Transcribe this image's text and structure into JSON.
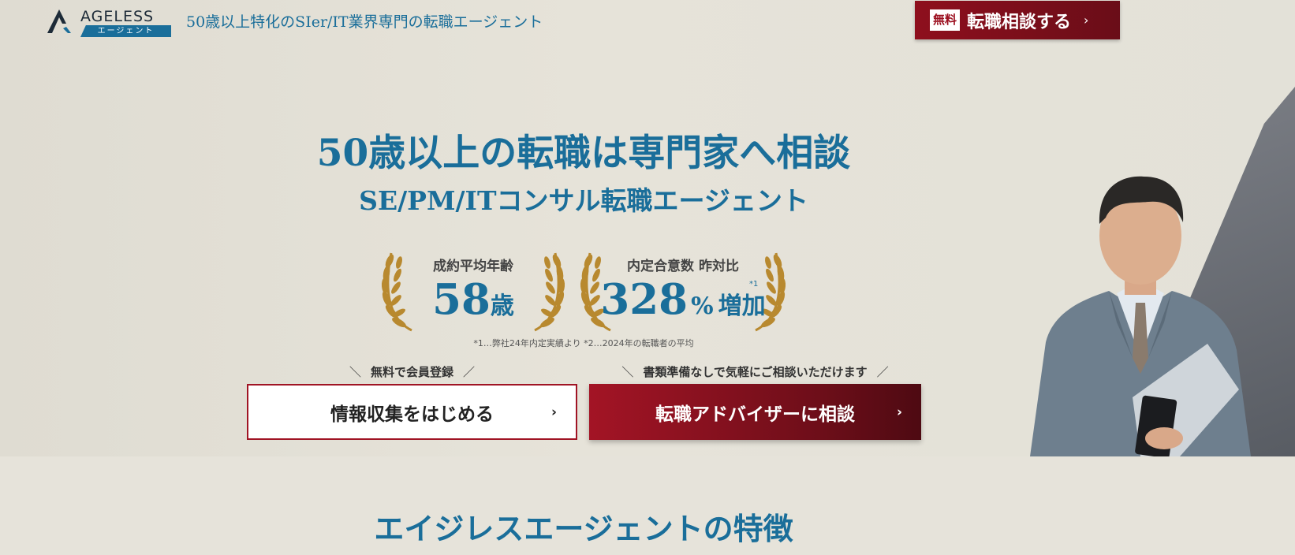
{
  "header": {
    "logo_text": "AGELESS",
    "logo_sub": "エージェント",
    "tagline": "50歳以上特化のSIer/IT業界専門の転職エージェント",
    "cta_badge": "無料",
    "cta_label": "転職相談する",
    "cta_chevron": "›"
  },
  "hero": {
    "headline": "50歳以上の転職は専門家へ相談",
    "subheadline": "SE/PM/ITコンサル転職エージェント",
    "awards": [
      {
        "label": "成約平均年齢",
        "value": "58",
        "unit": "歳"
      },
      {
        "label": "内定合意数 昨対比",
        "value": "328",
        "unit": "%",
        "suffix": "増加",
        "note": "*1"
      }
    ],
    "footnote": "*1…弊社24年内定実績より *2…2024年の転職者の平均",
    "cta_left_caption": "無料で会員登録",
    "cta_right_caption": "書類準備なしで気軽にご相談いただけます",
    "cta_left_label": "情報収集をはじめる",
    "cta_right_label": "転職アドバイザーに相談",
    "chevron": "›",
    "slash_left": "＼",
    "slash_right": "／"
  },
  "features": {
    "title": "エイジレスエージェントの特徴"
  },
  "colors": {
    "brand_blue": "#1a6e9a",
    "cta_red": "#a31425",
    "gold": "#b8892f",
    "background": "#e6e3da"
  },
  "icons": [
    "ageless-logo-icon",
    "laurel-wreath-icon",
    "chevron-right-icon"
  ]
}
